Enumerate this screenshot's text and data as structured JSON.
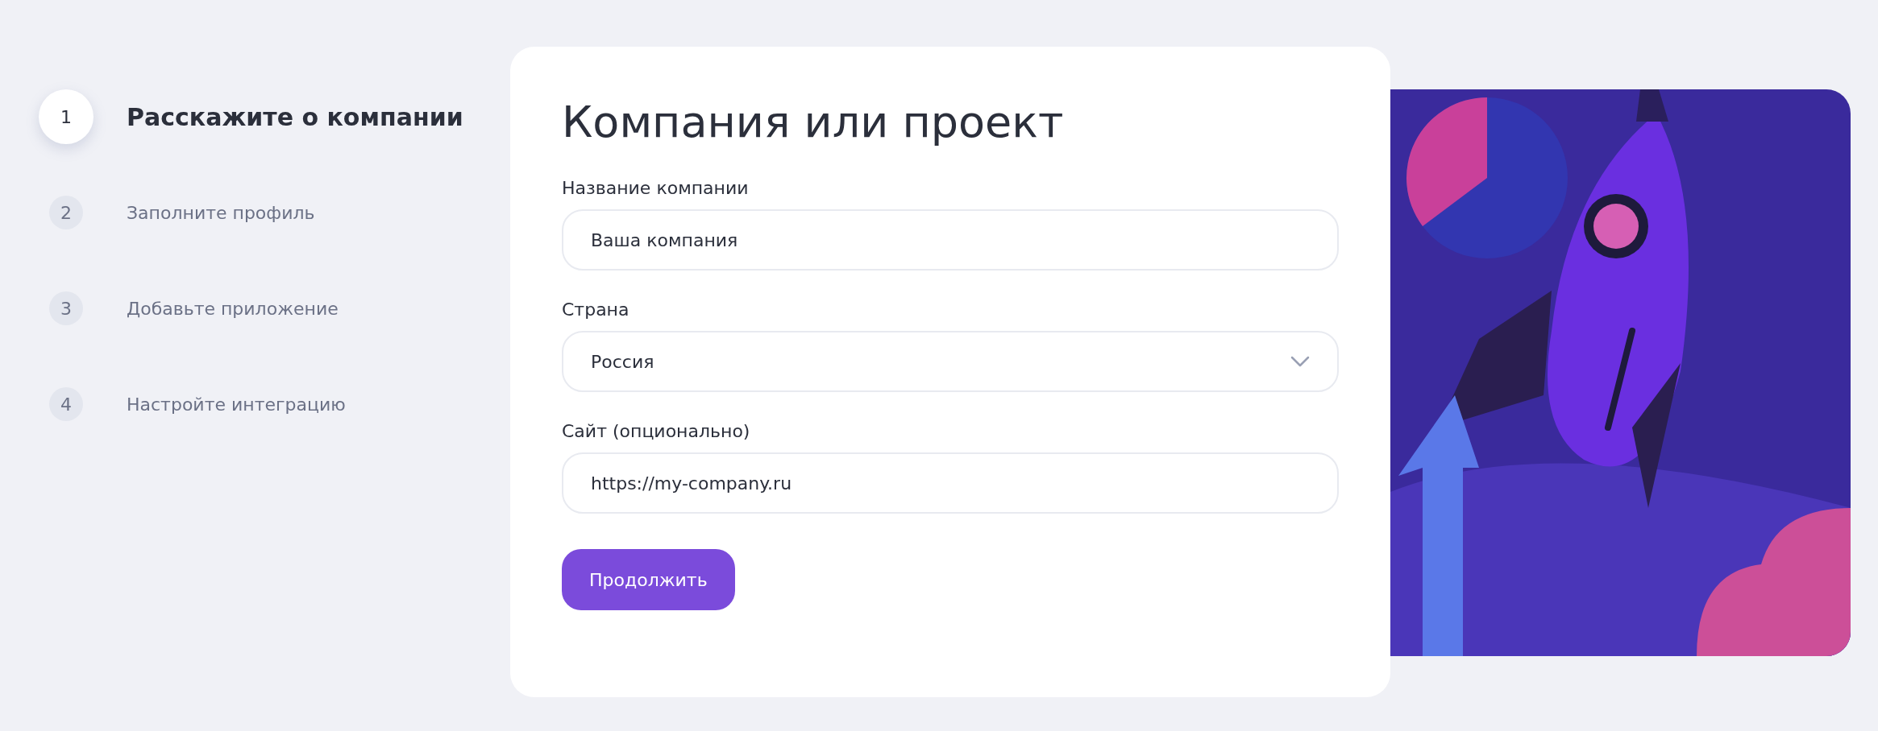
{
  "steps": [
    {
      "number": "1",
      "label": "Расскажите о компании",
      "selected": true
    },
    {
      "number": "2",
      "label": "Заполните профиль",
      "selected": false
    },
    {
      "number": "3",
      "label": "Добавьте приложение",
      "selected": false
    },
    {
      "number": "4",
      "label": "Настройте интеграцию",
      "selected": false
    }
  ],
  "form": {
    "title": "Компания или проект",
    "fields": [
      {
        "kind": "text",
        "label": "Название компании",
        "value": "Ваша компания"
      },
      {
        "kind": "select",
        "label": "Страна",
        "value": "Россия"
      },
      {
        "kind": "text",
        "label": "Сайт (опционально)",
        "value": "https://my-company.ru"
      }
    ],
    "submit": "Продолжить"
  }
}
